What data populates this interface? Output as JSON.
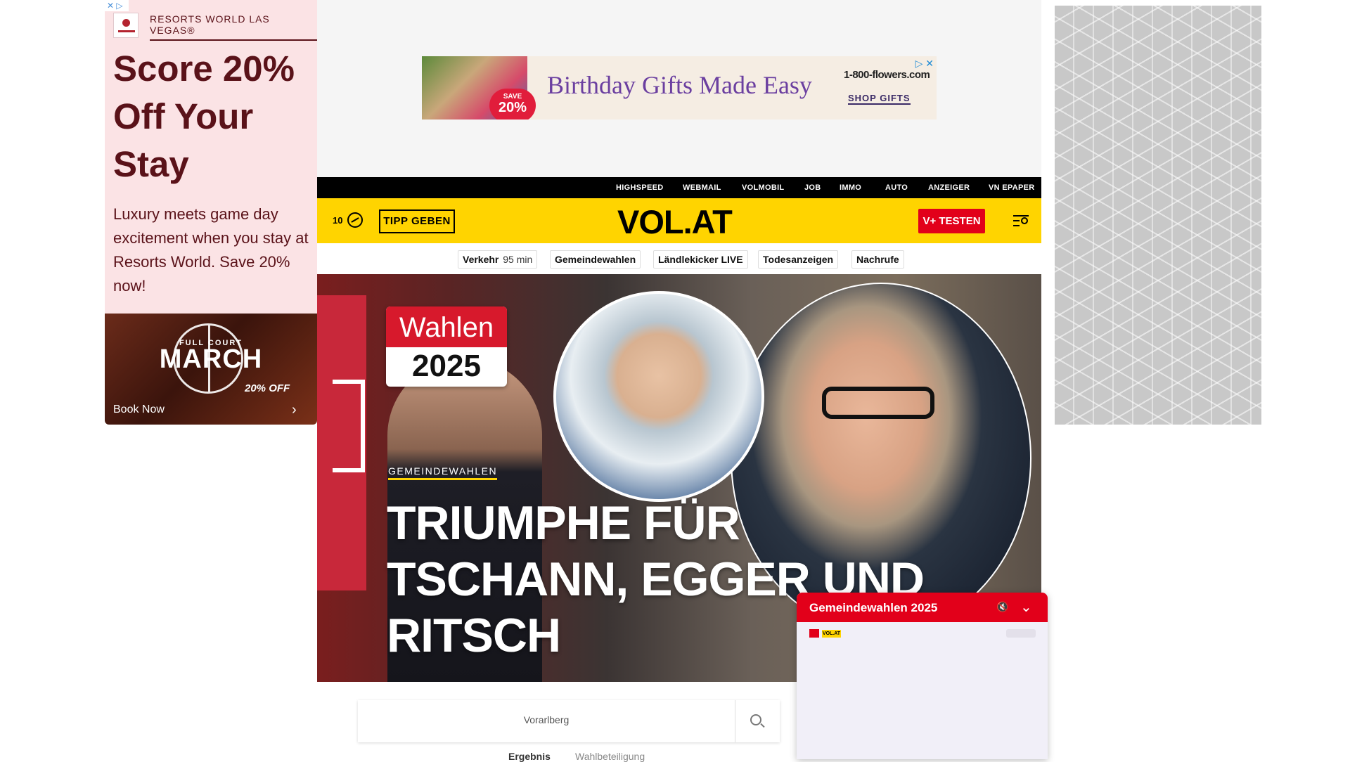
{
  "left_ad": {
    "adchoices": "✕ ▷",
    "brand": "RESORTS WORLD LAS VEGAS®",
    "headline": "Score 20% Off Your Stay",
    "body": "Luxury meets game day excitement when you stay at Resorts World. Save 20% now!",
    "promo_sub": "FULL COURT",
    "promo_title": "MARCH",
    "promo_offer": "20% OFF",
    "cta": "Book Now",
    "colors": {
      "background": "#fbe3e5",
      "text": "#5a1219"
    }
  },
  "banner_ad": {
    "badge_save": "SAVE",
    "badge_pct": "20%",
    "headline": "Birthday Gifts Made Easy",
    "brand": "1-800-flowers.com",
    "cta": "SHOP GIFTS",
    "adchoice": "▷ ✕"
  },
  "top_nav": {
    "links": [
      "HIGHSPEED",
      "WEBMAIL",
      "VOLMOBIL",
      "JOB",
      "IMMO",
      "AUTO",
      "ANZEIGER",
      "VN EPAPER"
    ]
  },
  "header": {
    "temperature": "10",
    "weather_icon": "cloud-sun-icon",
    "tipp_label": "TIPP GEBEN",
    "logo": "VOL.AT",
    "vplus_label": "V+ TESTEN",
    "menu_icon": "menu-search-icon",
    "colors": {
      "bar": "#ffd400",
      "accent": "#e2001a"
    }
  },
  "quick_links": [
    {
      "label": "Verkehr",
      "sub": "95 min"
    },
    {
      "label": "Gemeindewahlen",
      "sub": ""
    },
    {
      "label": "Ländlekicker LIVE",
      "sub": ""
    },
    {
      "label": "Todesanzeigen",
      "sub": ""
    },
    {
      "label": "Nachrufe",
      "sub": ""
    }
  ],
  "hero": {
    "badge_top": "Wahlen",
    "badge_year": "2025",
    "kicker": "GEMEINDEWAHLEN",
    "headline": "TRIUMPHE FÜR TSCHANN, EGGER UND RITSCH"
  },
  "election_widget": {
    "search_value": "Vorarlberg",
    "tabs": [
      "Ergebnis",
      "Wahlbeteiligung"
    ],
    "active_tab": "Ergebnis"
  },
  "video_player": {
    "title": "Gemeindewahlen 2025",
    "mute_icon": "volume-mute-icon",
    "collapse_icon": "chevron-down-icon",
    "logo_text": "VOL.AT"
  }
}
